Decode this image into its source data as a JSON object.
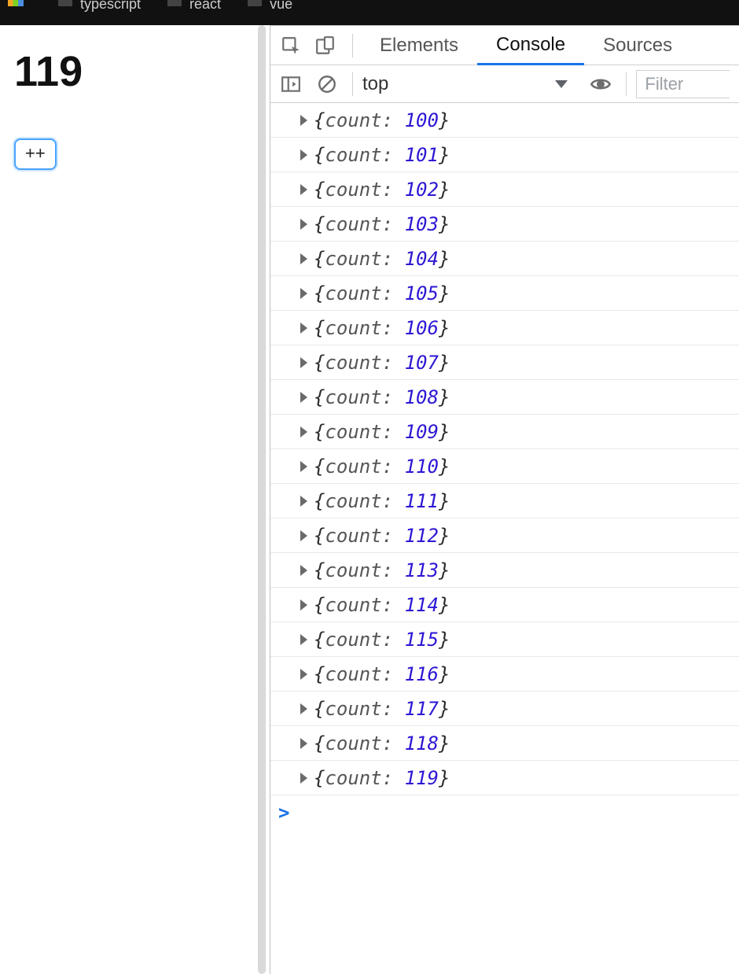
{
  "tabstrip": {
    "items": [
      {
        "label": ""
      },
      {
        "label": "typescript"
      },
      {
        "label": "react"
      },
      {
        "label": "vue"
      }
    ]
  },
  "page": {
    "count_display": "119",
    "increment_label": "++"
  },
  "devtools": {
    "tabs": {
      "elements": "Elements",
      "console": "Console",
      "sources": "Sources"
    },
    "toolbar": {
      "context": "top",
      "filter_placeholder": "Filter"
    },
    "logs": [
      {
        "key": "count",
        "value": "100"
      },
      {
        "key": "count",
        "value": "101"
      },
      {
        "key": "count",
        "value": "102"
      },
      {
        "key": "count",
        "value": "103"
      },
      {
        "key": "count",
        "value": "104"
      },
      {
        "key": "count",
        "value": "105"
      },
      {
        "key": "count",
        "value": "106"
      },
      {
        "key": "count",
        "value": "107"
      },
      {
        "key": "count",
        "value": "108"
      },
      {
        "key": "count",
        "value": "109"
      },
      {
        "key": "count",
        "value": "110"
      },
      {
        "key": "count",
        "value": "111"
      },
      {
        "key": "count",
        "value": "112"
      },
      {
        "key": "count",
        "value": "113"
      },
      {
        "key": "count",
        "value": "114"
      },
      {
        "key": "count",
        "value": "115"
      },
      {
        "key": "count",
        "value": "116"
      },
      {
        "key": "count",
        "value": "117"
      },
      {
        "key": "count",
        "value": "118"
      },
      {
        "key": "count",
        "value": "119"
      }
    ],
    "prompt": ">"
  }
}
